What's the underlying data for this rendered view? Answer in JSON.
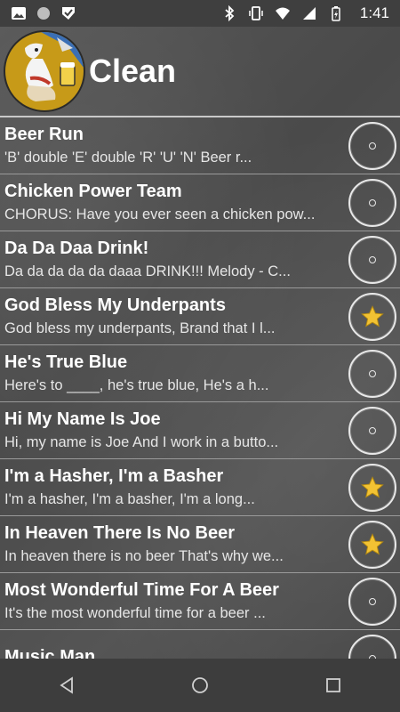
{
  "status": {
    "time": "1:41"
  },
  "header": {
    "title": "Clean"
  },
  "songs": [
    {
      "title": "Beer Run",
      "preview": "'B' double 'E' double 'R' 'U' 'N' Beer r...",
      "favorite": false
    },
    {
      "title": "Chicken Power Team",
      "preview": "CHORUS: Have you ever seen a chicken pow...",
      "favorite": false
    },
    {
      "title": "Da Da Daa Drink!",
      "preview": "Da da da da da daaa DRINK!!!  Melody - C...",
      "favorite": false
    },
    {
      "title": "God Bless My Underpants",
      "preview": "God bless my underpants,  Brand that I l...",
      "favorite": true
    },
    {
      "title": "He's True Blue",
      "preview": "Here's to ____, he's true blue, He's a h...",
      "favorite": false
    },
    {
      "title": "Hi My Name Is Joe",
      "preview": "Hi, my name is Joe And I work in a butto...",
      "favorite": false
    },
    {
      "title": "I'm a Hasher, I'm a Basher",
      "preview": "I'm a hasher,  I'm a basher,  I'm a long...",
      "favorite": true
    },
    {
      "title": "In Heaven There Is No Beer",
      "preview": "In heaven there is no beer That's why we...",
      "favorite": true
    },
    {
      "title": "Most Wonderful Time For A Beer",
      "preview": "It's the most wonderful time for a beer ...",
      "favorite": false
    },
    {
      "title": "Music Man",
      "preview": "",
      "favorite": false
    }
  ],
  "colors": {
    "star": "#f2c233",
    "ring": "#e8e8e8"
  },
  "icons": {
    "status_left": [
      "image-icon",
      "circle-icon",
      "check-icon"
    ],
    "status_right": [
      "bluetooth-icon",
      "vibrate-icon",
      "wifi-icon",
      "signal-icon",
      "battery-icon"
    ],
    "nav": [
      "back-icon",
      "home-icon",
      "recents-icon"
    ]
  }
}
